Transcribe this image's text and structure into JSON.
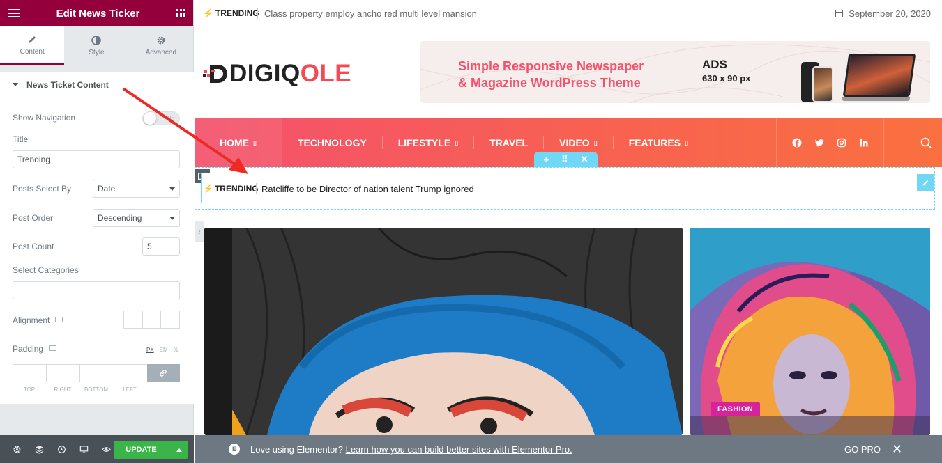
{
  "panel": {
    "header_title": "Edit News Ticker",
    "tabs": [
      {
        "label": "Content"
      },
      {
        "label": "Style"
      },
      {
        "label": "Advanced"
      }
    ],
    "section_title": "News Ticket Content",
    "show_navigation_label": "Show Navigation",
    "toggle_text": "No",
    "title_label": "Title",
    "title_value": "Trending",
    "posts_select_by_label": "Posts Select By",
    "posts_select_by_value": "Date",
    "post_order_label": "Post Order",
    "post_order_value": "Descending",
    "post_count_label": "Post Count",
    "post_count_value": "5",
    "select_categories_label": "Select Categories",
    "alignment_label": "Alignment",
    "padding_label": "Padding",
    "units": [
      "PX",
      "EM",
      "%"
    ],
    "dimension_labels": [
      "TOP",
      "RIGHT",
      "BOTTOM",
      "LEFT"
    ],
    "update_label": "UPDATE"
  },
  "site": {
    "topbar_trending": "TRENDING",
    "topbar_text": "Class property employ ancho red multi level mansion",
    "date": "September 20, 2020",
    "logo_dark": "DIGIQ",
    "logo_red": "OLE",
    "ad_text": "Simple Responsive Newspaper & Magazine WordPress Theme",
    "ad_title": "ADS",
    "ad_size": "630 x 90 px",
    "nav": [
      "HOME",
      "TECHNOLOGY",
      "LIFESTYLE",
      "TRAVEL",
      "VIDEO",
      "FEATURES"
    ],
    "ticker_label": "TRENDING",
    "ticker_text": "Ratcliffe to be Director of nation talent Trump ignored",
    "category_badge": "FASHION"
  },
  "notice": {
    "prefix": "Love using Elementor? ",
    "link": "Learn how you can build better sites with Elementor Pro.",
    "gopro": "GO PRO",
    "close": "✕"
  },
  "colors": {
    "brand": "#93003c",
    "accent": "#f44a56",
    "elementor_blue": "#71d7f7",
    "update_green": "#39b54a"
  }
}
